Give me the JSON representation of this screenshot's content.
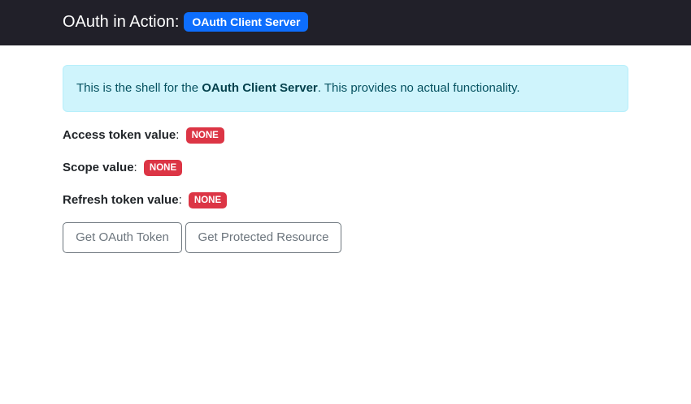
{
  "navbar": {
    "brand_text": "OAuth in Action:",
    "brand_badge": "OAuth Client Server"
  },
  "alert": {
    "prefix": "This is the shell for the ",
    "strong": "OAuth Client Server",
    "suffix": ". This provides no actual functionality."
  },
  "fields": {
    "access_token": {
      "label": "Access token value",
      "separator": ":",
      "value": "NONE"
    },
    "scope": {
      "label": "Scope value",
      "separator": ":",
      "value": "NONE"
    },
    "refresh_token": {
      "label": "Refresh token value",
      "separator": ":",
      "value": "NONE"
    }
  },
  "buttons": {
    "get_token": "Get OAuth Token",
    "get_resource": "Get Protected Resource"
  },
  "colors": {
    "navbar_bg": "#212029",
    "brand_badge_bg": "#0d6efd",
    "alert_bg": "#cff4fc",
    "alert_text": "#055160",
    "badge_danger": "#dc3545",
    "button_outline": "#6c757d"
  }
}
